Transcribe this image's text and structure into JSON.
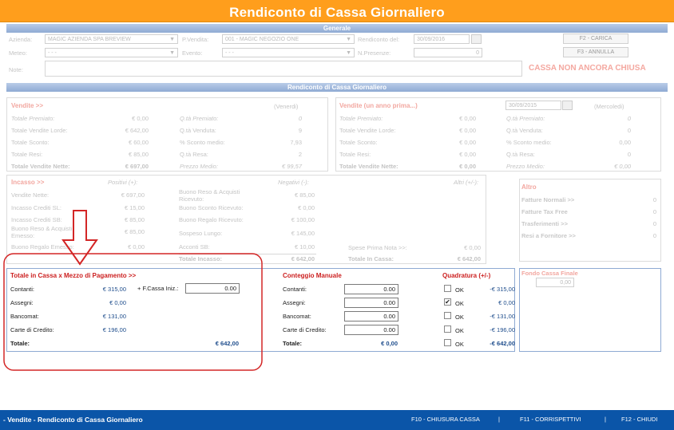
{
  "title": "Rendiconto di Cassa Giornaliero",
  "generale": {
    "header": "Generale",
    "azienda_label": "Azienda:",
    "azienda_value": "MAGIC AZIENDA SPA BREVIEW",
    "pvendita_label": "P.Vendita:",
    "pvendita_value": "001 - MAGIC NEGOZIO ONE",
    "rendiconto_label": "Rendiconto del:",
    "rendiconto_value": "30/09/2016",
    "meteo_label": "Meteo:",
    "meteo_value": "- - -",
    "evento_label": "Evento:",
    "evento_value": "- - -",
    "presenze_label": "N.Presenze:",
    "presenze_value": "0",
    "note_label": "Note:",
    "carica_button": "F2 - CARICA",
    "annulla_button": "F3 - ANNULLA",
    "status": "CASSA NON ANCORA CHIUSA"
  },
  "rendiconto_header": "Rendiconto di Cassa Giornaliero",
  "vendite": {
    "title": "Vendite >>",
    "day": "(Venerdi)",
    "rows": [
      {
        "l1": "Totale Premiato:",
        "v1": "€ 0,00",
        "l2": "Q.tà Premiato:",
        "v2": "0"
      },
      {
        "l1": "Totale Vendite Lorde:",
        "v1": "€ 642,00",
        "l2": "Q.tà Venduta:",
        "v2": "9"
      },
      {
        "l1": "Totale Sconto:",
        "v1": "€ 60,00",
        "l2": "% Sconto medio:",
        "v2": "7,93"
      },
      {
        "l1": "Totale Resi:",
        "v1": "€ 85,00",
        "l2": "Q.tà Resa:",
        "v2": "2"
      },
      {
        "l1": "Totale Vendite Nette:",
        "v1": "€ 697,00",
        "l2": "Prezzo Medio:",
        "v2": "€ 99,57"
      }
    ]
  },
  "vendite_prev": {
    "title": "Vendite (un anno prima...)",
    "date": "30/09/2015",
    "day": "(Mercoledi)",
    "rows": [
      {
        "l1": "Totale Premiato:",
        "v1": "€ 0,00",
        "l2": "Q.tà Premiato:",
        "v2": "0"
      },
      {
        "l1": "Totale Vendite Lorde:",
        "v1": "€ 0,00",
        "l2": "Q.tà Venduta:",
        "v2": "0"
      },
      {
        "l1": "Totale Sconto:",
        "v1": "€ 0,00",
        "l2": "% Sconto medio:",
        "v2": "0,00"
      },
      {
        "l1": "Totale Resi:",
        "v1": "€ 0,00",
        "l2": "Q.tà Resa:",
        "v2": "0"
      },
      {
        "l1": "Totale Vendite Nette:",
        "v1": "€ 0,00",
        "l2": "Prezzo Medio:",
        "v2": "€ 0,00"
      }
    ]
  },
  "incasso": {
    "title": "Incasso >>",
    "positivi": "Positivi (+):",
    "negativi": "Negativi (-):",
    "altri": "Altri (+/-):",
    "col1": [
      {
        "l": "Vendite Nette:",
        "v": "€ 697,00"
      },
      {
        "l": "Incasso Crediti SL:",
        "v": "€ 15,00"
      },
      {
        "l": "Incasso Crediti SB:",
        "v": "€ 85,00"
      },
      {
        "l": "Buono Reso & Acquisti Emesso:",
        "v": "€ 85,00"
      },
      {
        "l": "Buono Regalo Emesso:",
        "v": "€ 0,00"
      }
    ],
    "col2": [
      {
        "l": "Buono Reso & Acquisti Ricevuto:",
        "v": "€ 85,00"
      },
      {
        "l": "Buono Sconto Ricevuto:",
        "v": "€ 0,00"
      },
      {
        "l": "Buono Regalo Ricevuto:",
        "v": "€ 100,00"
      },
      {
        "l": "Sospeso Lungo:",
        "v": "€ 145,00"
      },
      {
        "l": "Acconti SB:",
        "v": "€ 10,00"
      }
    ],
    "totale_incasso_label": "Totale Incasso:",
    "totale_incasso_value": "€ 642,00",
    "spese_label": "Spese Prima Nota >>:",
    "spese_value": "€ 0,00",
    "totale_cassa_label": "Totale In Cassa:",
    "totale_cassa_value": "€ 642,00"
  },
  "altro": {
    "title": "Altro",
    "rows": [
      {
        "l": "Fatture Normali >>",
        "v": "0"
      },
      {
        "l": "Fatture Tax Free",
        "v": "0"
      },
      {
        "l": "Trasferimenti >>",
        "v": "0"
      },
      {
        "l": "Resi a Fornitore >>",
        "v": "0"
      }
    ]
  },
  "fondo": {
    "title": "Fondo Cassa Finale",
    "value": "0,00"
  },
  "quadratura_panel": {
    "totale_title": "Totale in Cassa x Mezzo di Pagamento >>",
    "fcassa_label": "+ F.Cassa Iniz.:",
    "fcassa_value": "0.00",
    "conteggio_title": "Conteggio Manuale",
    "quadratura_title": "Quadratura (+/-)",
    "ok_label": "OK",
    "rows": [
      {
        "l": "Contanti:",
        "v": "€ 315,00",
        "input": "0.00",
        "checked": false,
        "q": "-€ 315,00"
      },
      {
        "l": "Assegni:",
        "v": "€ 0,00",
        "input": "0.00",
        "checked": true,
        "q": "€ 0,00"
      },
      {
        "l": "Bancomat:",
        "v": "€ 131,00",
        "input": "0.00",
        "checked": false,
        "q": "-€ 131,00"
      },
      {
        "l": "Carte di Credito:",
        "v": "€ 196,00",
        "input": "0.00",
        "checked": false,
        "q": "-€ 196,00"
      }
    ],
    "totale_label": "Totale:",
    "totale_value": "€ 642,00",
    "totale_manuale": "€ 0,00",
    "totale_quadratura": "-€ 642,00"
  },
  "footer": {
    "breadcrumb": "- Vendite - Rendiconto di Cassa Giornaliero",
    "f10": "F10 - CHIUSURA CASSA",
    "f11": "F11 - CORRISPETTIVI",
    "f12": "F12 - CHIUDI",
    "sep": "|"
  },
  "colors": {
    "title_bg": "#ff9e1c",
    "footer_bg": "#0b55a8",
    "annotation_red": "#d32626",
    "section_header": "#8faad3"
  }
}
